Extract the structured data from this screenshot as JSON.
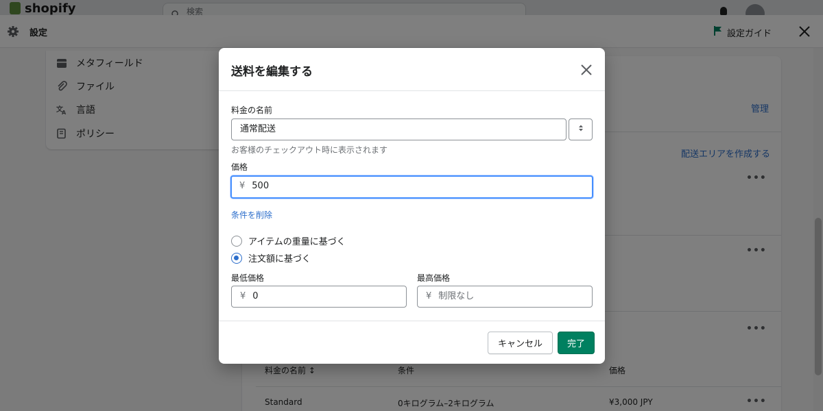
{
  "topbar": {
    "brand": "shopify",
    "search_placeholder": "検索"
  },
  "settings_header": {
    "title": "設定",
    "guide_label": "設定ガイド"
  },
  "sidebar": {
    "items": [
      {
        "label": "メタフィールド",
        "icon": "calendar-icon"
      },
      {
        "label": "ファイル",
        "icon": "paperclip-icon"
      },
      {
        "label": "言語",
        "icon": "translate-icon"
      },
      {
        "label": "ポリシー",
        "icon": "policy-icon"
      }
    ]
  },
  "background_card": {
    "manage_link": "管理",
    "create_zone_link": "配送エリアを作成する",
    "table_headers": [
      "料金の名前",
      "条件",
      "価格"
    ],
    "table_row": {
      "name": "Standard",
      "condition": "0キログラム–2キログラム",
      "price": "¥3,000 JPY"
    }
  },
  "modal": {
    "title": "送料を編集する",
    "rate_name": {
      "label": "料金の名前",
      "value": "通常配送",
      "help": "お客様のチェックアウト時に表示されます"
    },
    "price": {
      "label": "価格",
      "prefix": "¥",
      "value": "500"
    },
    "remove_conditions_link": "条件を削除",
    "radio_options": [
      {
        "label": "アイテムの重量に基づく",
        "checked": false
      },
      {
        "label": "注文額に基づく",
        "checked": true
      }
    ],
    "min_price": {
      "label": "最低価格",
      "prefix": "¥",
      "value": "0"
    },
    "max_price": {
      "label": "最高価格",
      "prefix": "¥",
      "placeholder": "制限なし"
    },
    "cancel_label": "キャンセル",
    "done_label": "完了"
  },
  "colors": {
    "primary": "#008060",
    "link": "#2c6ecb",
    "focus": "#458fff"
  }
}
